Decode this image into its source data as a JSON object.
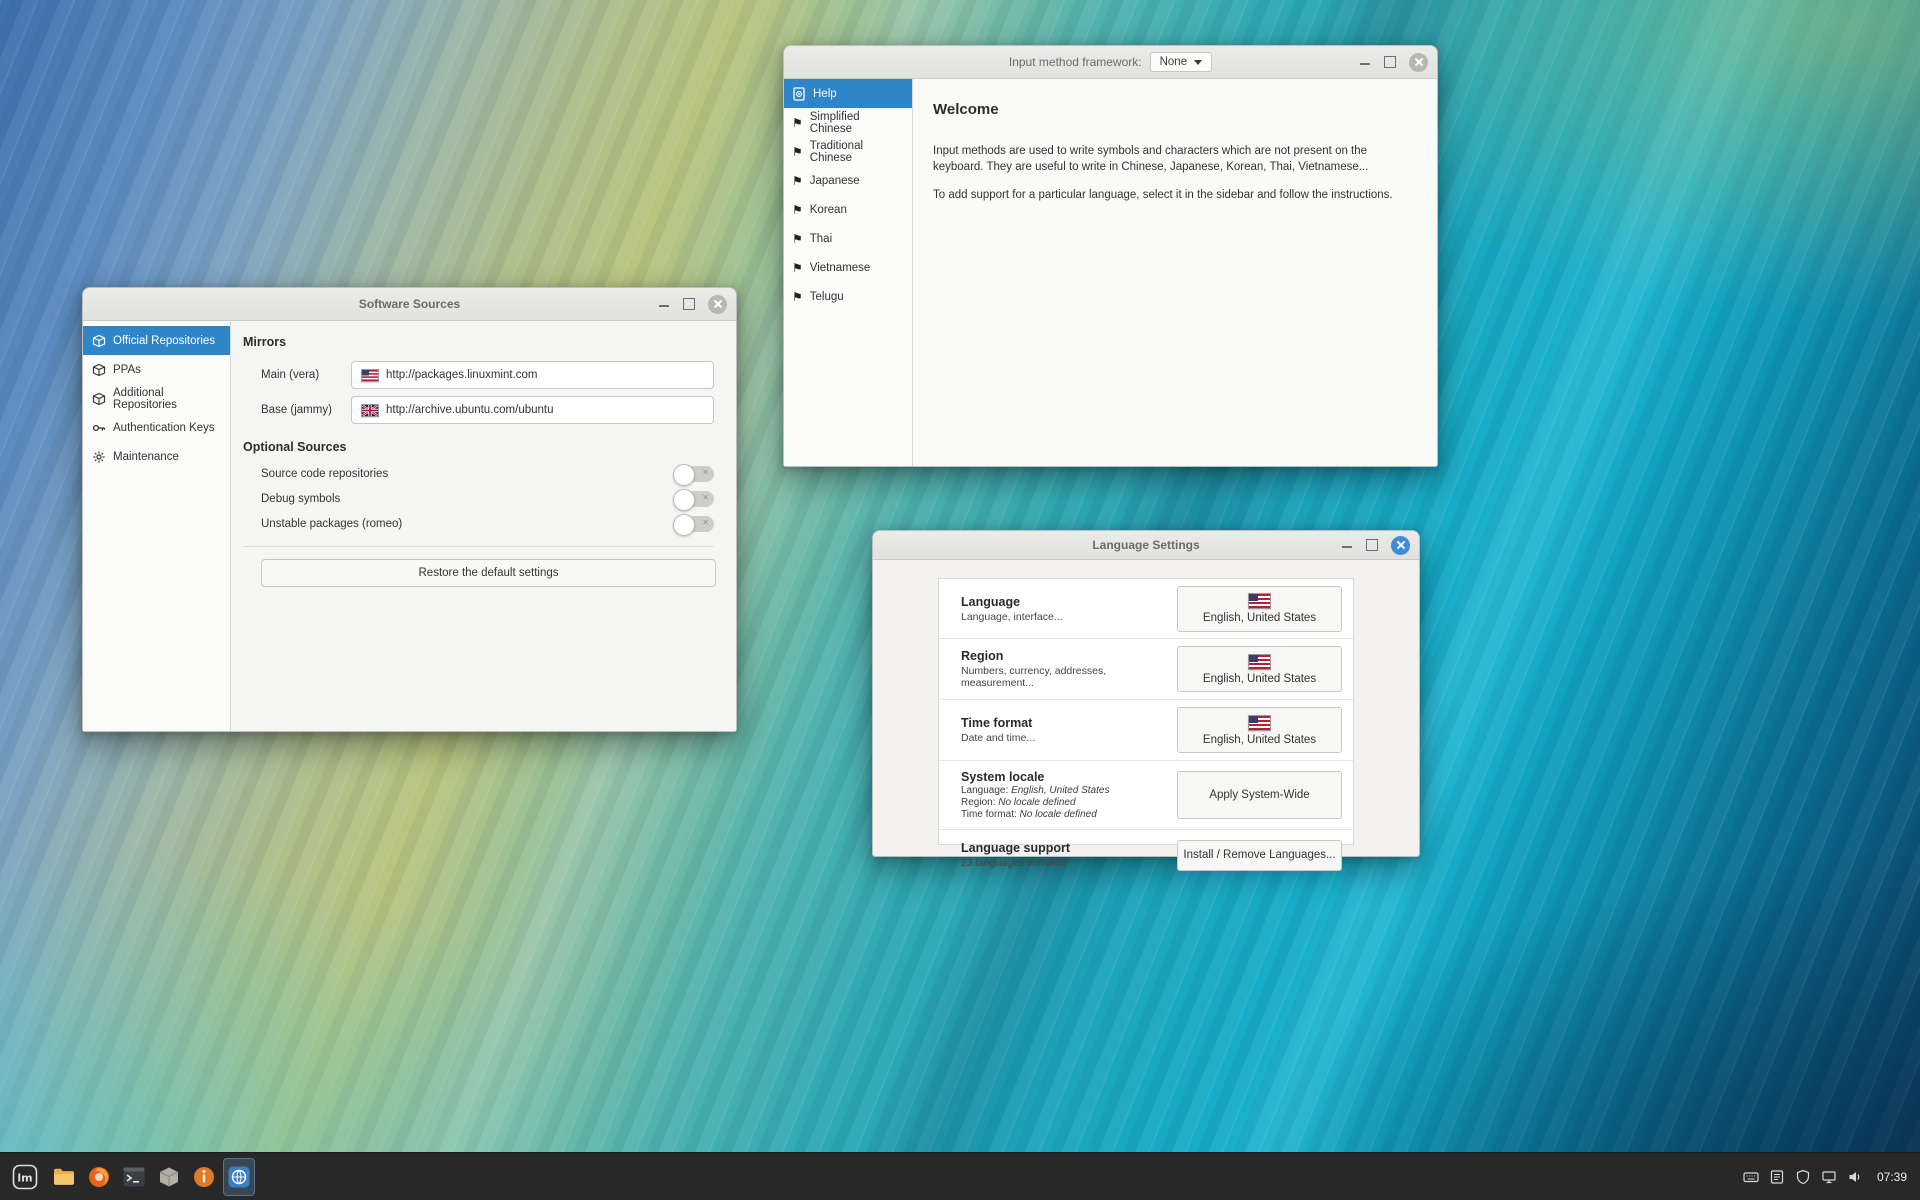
{
  "colors": {
    "accent_blue": "#2e86c9",
    "focused_close": "#3f8dd6",
    "taskbar_bg": "#282828",
    "titlebar_bg": "#e6e6e4",
    "window_bg": "#f5f5f4"
  },
  "icons": {
    "sidebar_flag": "black-flag-glyph",
    "help": "document-icon",
    "repository": "package-cube-icon",
    "auth": "key-icon",
    "maintenance": "gear-icon",
    "flags": [
      "us-flag",
      "uk-flag"
    ]
  },
  "windows": {
    "input_methods": {
      "titlebar_label": "Input method framework:",
      "framework_value": "None",
      "sidebar": [
        {
          "label": "Help",
          "selected": true
        },
        {
          "label": "Simplified Chinese"
        },
        {
          "label": "Traditional Chinese"
        },
        {
          "label": "Japanese"
        },
        {
          "label": "Korean"
        },
        {
          "label": "Thai"
        },
        {
          "label": "Vietnamese"
        },
        {
          "label": "Telugu"
        }
      ],
      "content": {
        "heading": "Welcome",
        "paragraph1": "Input methods are used to write symbols and characters which are not present on the keyboard. They are useful to write in Chinese, Japanese, Korean, Thai, Vietnamese...",
        "paragraph2": "To add support for a particular language, select it in the sidebar and follow the instructions."
      }
    },
    "software_sources": {
      "title": "Software Sources",
      "sidebar": [
        {
          "label": "Official Repositories",
          "selected": true
        },
        {
          "label": "PPAs"
        },
        {
          "label": "Additional Repositories"
        },
        {
          "label": "Authentication Keys"
        },
        {
          "label": "Maintenance"
        }
      ],
      "mirrors_heading": "Mirrors",
      "main_label": "Main (vera)",
      "main_value": "http://packages.linuxmint.com",
      "base_label": "Base (jammy)",
      "base_value": "http://archive.ubuntu.com/ubuntu",
      "optional_heading": "Optional Sources",
      "toggles": [
        "Source code repositories",
        "Debug symbols",
        "Unstable packages (romeo)"
      ],
      "restore_button": "Restore the default settings"
    },
    "language_settings": {
      "title": "Language Settings",
      "rows": {
        "language": {
          "title": "Language",
          "desc": "Language, interface...",
          "button": "English, United States"
        },
        "region": {
          "title": "Region",
          "desc": "Numbers, currency, addresses, measurement...",
          "button": "English, United States"
        },
        "time_format": {
          "title": "Time format",
          "desc": "Date and time...",
          "button": "English, United States"
        },
        "system_locale": {
          "title": "System locale",
          "l1": "Language:",
          "v1": "English, United States",
          "l2": "Region:",
          "v2": "No locale defined",
          "l3": "Time format:",
          "v3": "No locale defined",
          "button": "Apply System-Wide"
        },
        "language_support": {
          "title": "Language support",
          "desc": "23 languages installed",
          "button": "Install / Remove Languages..."
        }
      }
    }
  },
  "taskbar": {
    "clock": "07:39"
  }
}
